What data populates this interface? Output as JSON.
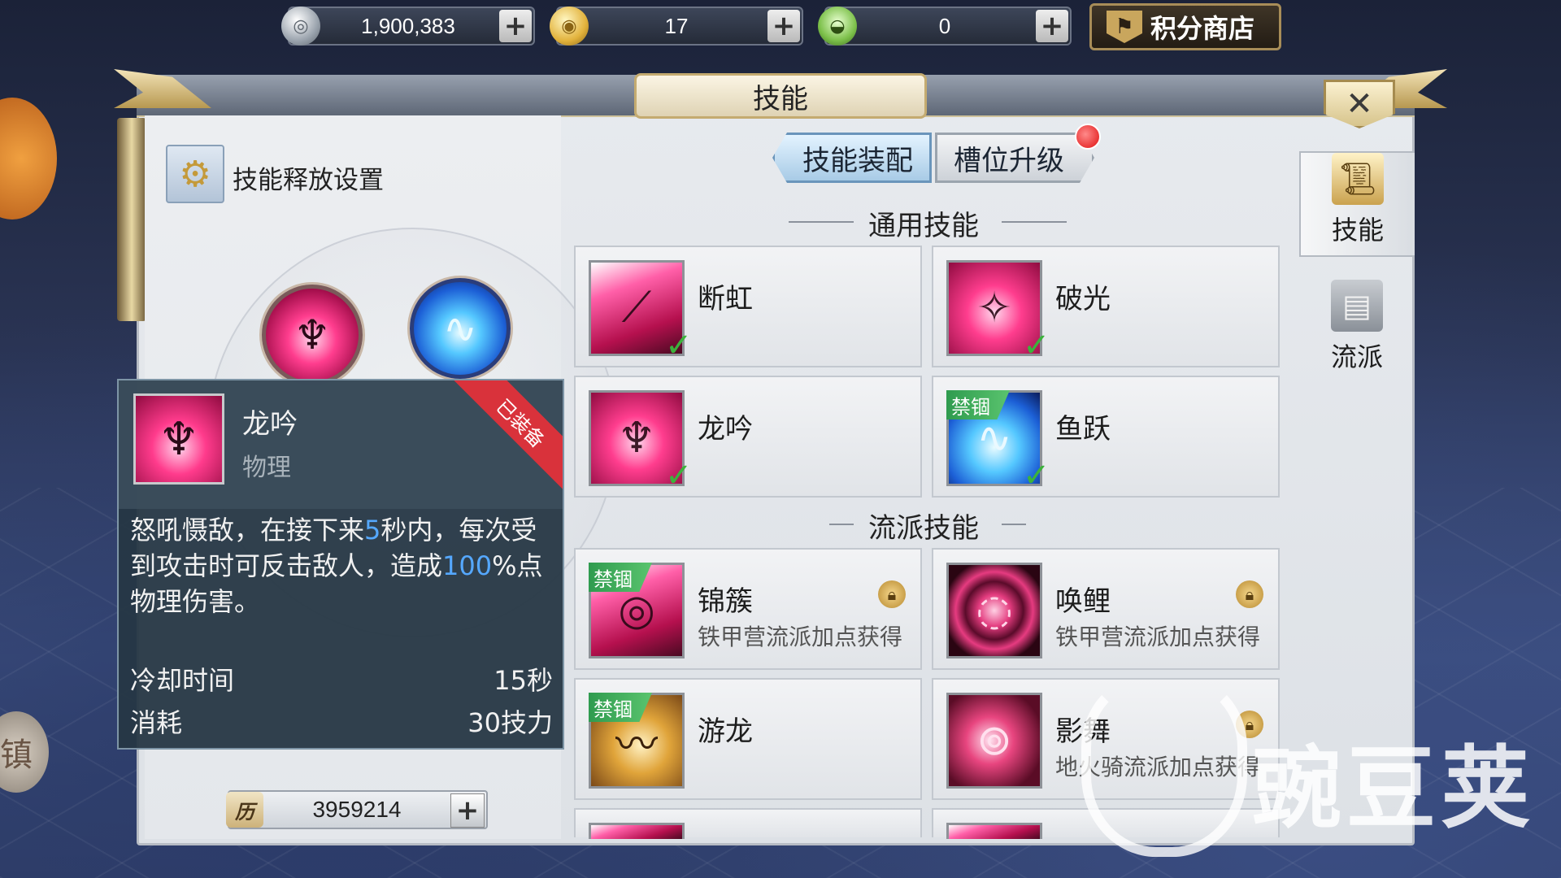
{
  "currencies": [
    {
      "icon": "silver-coin-icon",
      "value": "1,900,383"
    },
    {
      "icon": "gold-coin-icon",
      "value": "17"
    },
    {
      "icon": "ingot-icon",
      "value": "0"
    }
  ],
  "shop_button": "积分商店",
  "panel": {
    "title": "技能",
    "close": "✕"
  },
  "release_settings": "技能释放设置",
  "tabs": {
    "equip": "技能装配",
    "upgrade": "槽位升级"
  },
  "sections": {
    "general": "通用技能",
    "school": "流派技能"
  },
  "general_skills": [
    {
      "name": "断虹",
      "equipped": true
    },
    {
      "name": "破光",
      "equipped": true
    },
    {
      "name": "龙吟",
      "equipped": true
    },
    {
      "name": "鱼跃",
      "equipped": true,
      "badge": "禁锢"
    }
  ],
  "school_skills": [
    {
      "name": "锦簇",
      "badge": "禁锢",
      "note": "铁甲营流派加点获得",
      "locked": true
    },
    {
      "name": "唤鲤",
      "note": "铁甲营流派加点获得",
      "locked": true
    },
    {
      "name": "游龙",
      "badge": "禁锢"
    },
    {
      "name": "影舞",
      "note": "地火骑流派加点获得",
      "locked": true
    }
  ],
  "tooltip": {
    "name": "龙吟",
    "type": "物理",
    "ribbon": "已装备",
    "desc_1": "怒吼慑敌，在接下来",
    "desc_num1": "5",
    "desc_2": "秒内，每次受到攻击时可反击敌人，造成",
    "desc_num2": "100",
    "desc_3": "%点物理伤害。",
    "cooldown_label": "冷却时间",
    "cooldown_value": "15秒",
    "cost_label": "消耗",
    "cost_value": "30技力"
  },
  "bottom_currency": {
    "icon_text": "历",
    "value": "3959214"
  },
  "side_tabs": [
    {
      "label": "技能",
      "active": true
    },
    {
      "label": "流派",
      "active": false
    }
  ],
  "watermark": "豌豆荚"
}
